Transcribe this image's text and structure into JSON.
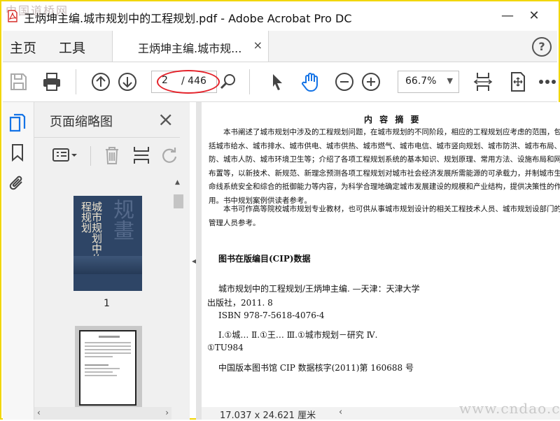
{
  "window": {
    "title": "王炳坤主编.城市规划中的工程规划.pdf - Adobe Acrobat Pro DC",
    "watermark_top": "中国道桥网"
  },
  "menu": {
    "home": "主页",
    "tools": "工具",
    "help_label": "?"
  },
  "tab": {
    "label": "王炳坤主编.城市规...",
    "close": "×"
  },
  "toolbar": {
    "page_current": "2",
    "page_total": "/ 446",
    "zoom": "66.7%"
  },
  "panel": {
    "title": "页面缩略图",
    "thumb_page_number": "1"
  },
  "thumbnail": {
    "cover_title": "城市规划中的工程规划",
    "cover_big": "规畫"
  },
  "document": {
    "abstract_title": "内 容 摘 要",
    "abstract_p1": "本书阐述了城市规划中涉及的工程规划问题，在城市规划的不同阶段，相应的工程规划应考虑的范围，包括城市给水、城市排水、城市供电、城市供热、城市燃气、城市电信、城市竖向规划、城市防洪、城市布局、防、城市人防、城市环境卫生等；介绍了各项工程规划系统的基本知识、规划原理、常用方法、设施布局和网布置等，以新技术、新规范、新理念预测各项工程规划对城市社会经济发展所需能源的可承载力，并制城市生命线系统安全和综合的抵御能力等内容，为科学合理地确定城市发展建设的规模和产业结构，提供决策性的作用。书中规划案例供读者参考。",
    "abstract_p2": "本书可作高等院校城市规划专业教材，也可供从事城市规划设计的相关工程技术人员、城市规划设部门的管理人员参考。",
    "cip_title": "图书在版编目(CIP)数据",
    "cip_lines": [
      "城市规划中的工程规划/王炳坤主编. —天津：天津大学",
      "出版社，2011. 8",
      "ISBN 978-7-5618-4076-4",
      "Ⅰ.①城…   Ⅱ.①王…   Ⅲ.①城市规划－研究   Ⅳ.",
      "①TU984",
      "中国版本图书馆 CIP 数据核字(2011)第 160688 号"
    ]
  },
  "status": {
    "page_size": "17.037 x 24.621 厘米"
  },
  "watermark_bottom": "www.cndao.com"
}
